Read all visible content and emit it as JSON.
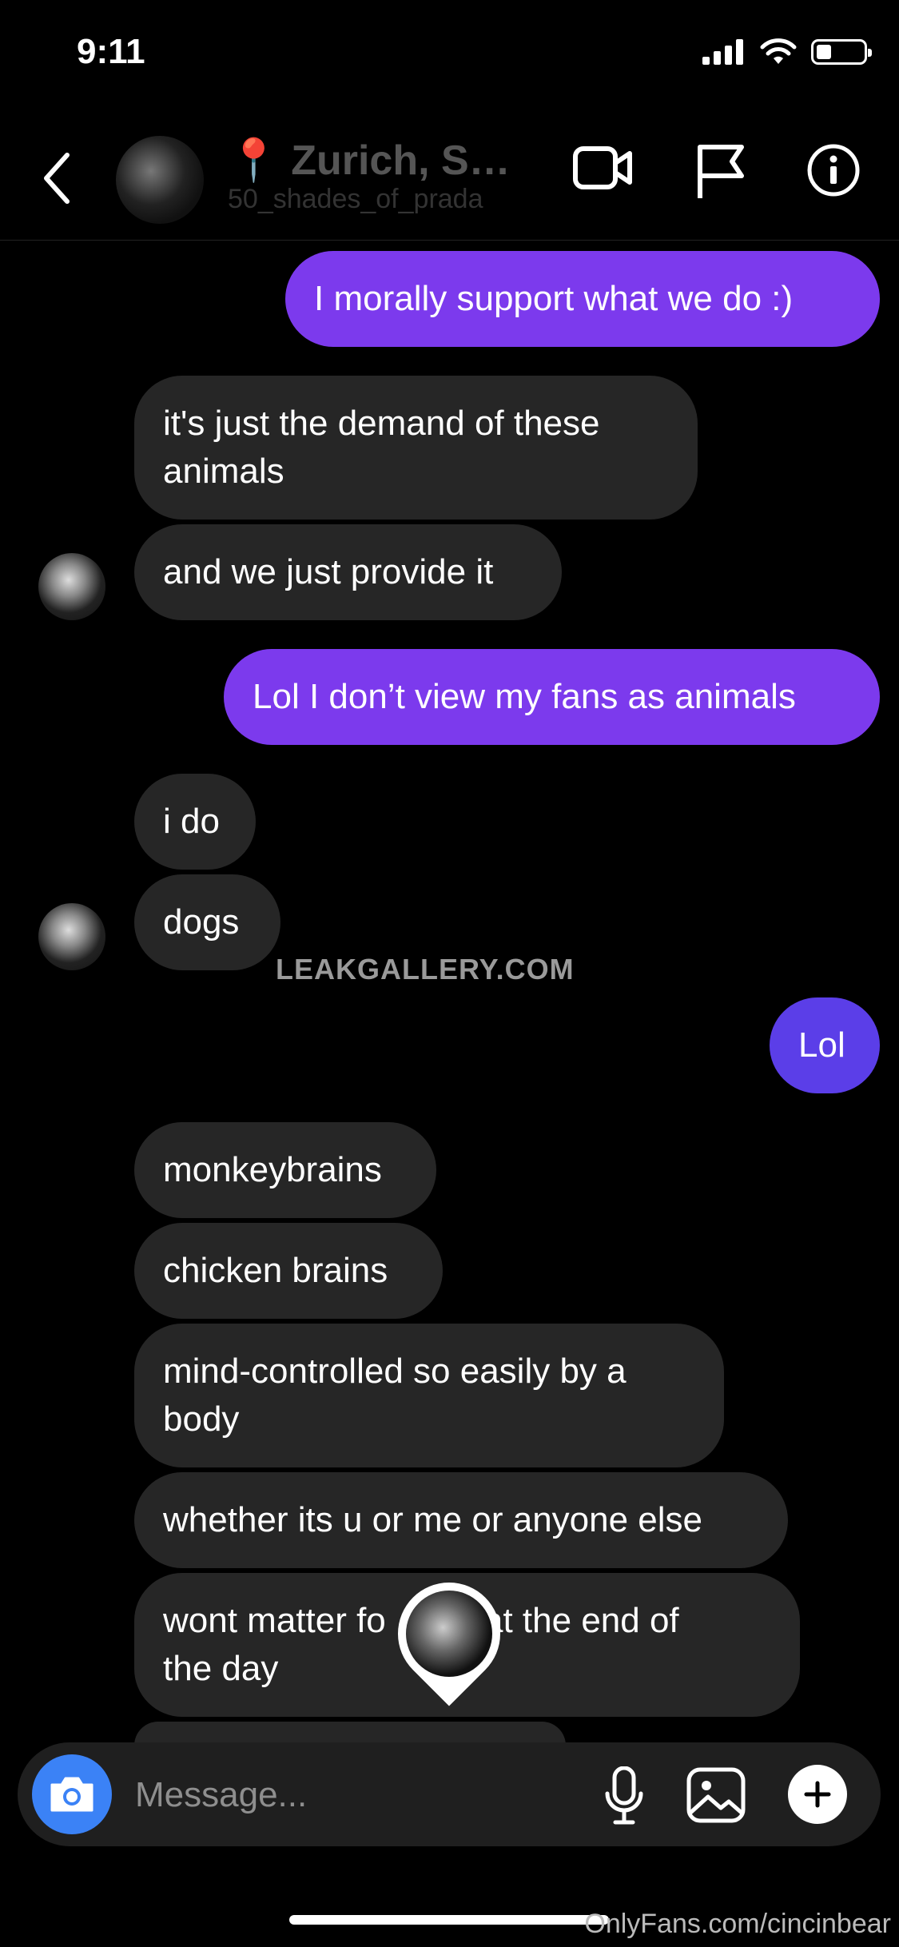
{
  "status": {
    "time": "9:11"
  },
  "header": {
    "title": "📍 Zurich, Swi...",
    "subtitle": "50_shades_of_prada"
  },
  "messages": [
    {
      "text": "I morally support what we do :)"
    },
    {
      "text": "it's just the demand of these\nanimals"
    },
    {
      "text": "and we just provide it"
    },
    {
      "text": "Lol I don’t view my fans as animals"
    },
    {
      "text": "i do"
    },
    {
      "text": "dogs"
    },
    {
      "text": "Lol"
    },
    {
      "text": "monkeybrains"
    },
    {
      "text": "chicken brains"
    },
    {
      "text": "mind-controlled so easily by a\nbody"
    },
    {
      "text": "whether its u or me or anyone else"
    },
    {
      "text": "wont matter fo      m at the end of\nthe day"
    }
  ],
  "watermark": "LEAKGALLERY.COM",
  "composer": {
    "placeholder": "Message..."
  },
  "footer_watermark": "OnlyFans.com/cincinbear",
  "colors": {
    "outgoing": "#7c3aed",
    "outgoing_alt": "#5b3ee8",
    "incoming": "#262626",
    "camera": "#3b82f6"
  }
}
